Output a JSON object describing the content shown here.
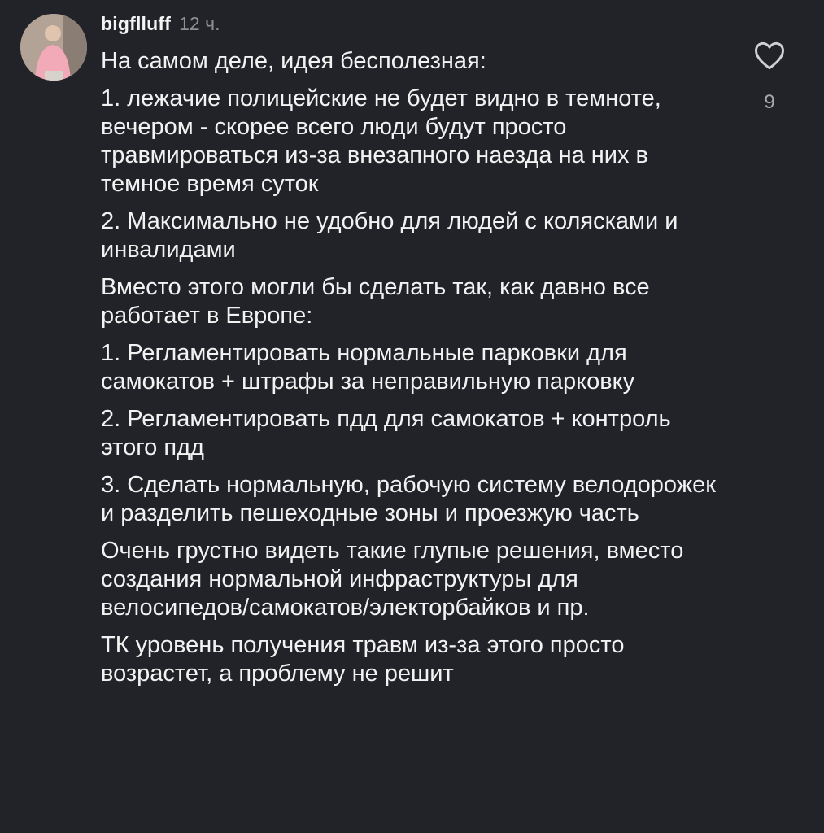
{
  "comment": {
    "username": "bigflluff",
    "time": "12 ч.",
    "like_count": "9",
    "paragraphs": [
      "На самом деле, идея бесполезная:",
      "1. лежачие полицейские не будет видно в темноте, вечером - скорее всего люди будут просто травмироваться из-за внезапного наезда на них в темное время суток",
      "2. Максимально не удобно для людей с колясками и инвалидами",
      "Вместо этого могли бы сделать так, как давно все работает в Европе:",
      "1. Регламентировать нормальные парковки для самокатов + штрафы за неправильную парковку",
      "2. Регламентировать пдд для самокатов + контроль этого пдд",
      "3. Сделать нормальную, рабочую систему велодорожек и разделить пешеходные зоны и проезжую часть",
      "Очень грустно видеть такие глупые решения, вместо создания нормальной инфраструктуры для велосипедов/самокатов/электорбайков и пр.",
      "ТК уровень получения травм из-за этого просто возрастет, а проблему не решит"
    ]
  },
  "icons": {
    "like": "heart-outline-icon",
    "avatar": "user-avatar"
  },
  "colors": {
    "background": "#212329",
    "text": "#f2f2f2",
    "muted": "#8e9095"
  }
}
